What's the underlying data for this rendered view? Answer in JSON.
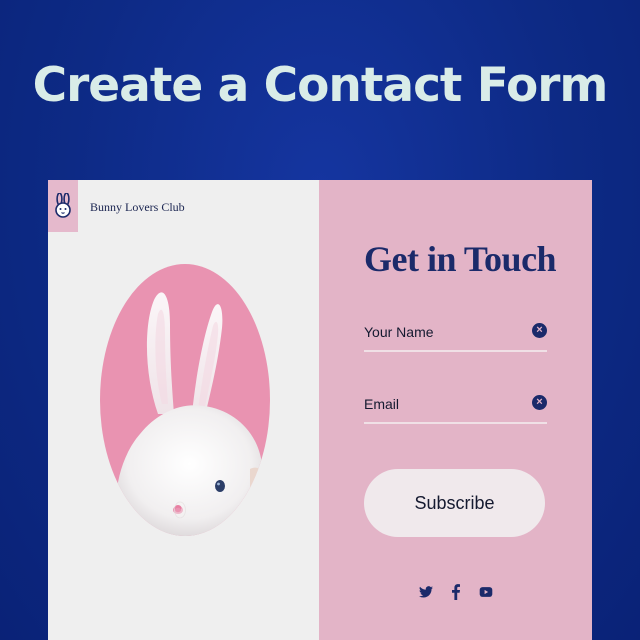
{
  "headline": "Create a Contact Form",
  "brand": {
    "name": "Bunny Lovers Club",
    "logo_icon": "bunny-icon"
  },
  "hero_image": {
    "icon": "bunny-photo"
  },
  "form": {
    "title": "Get in Touch",
    "fields": [
      {
        "label": "Your Name",
        "clear_icon": "clear-icon"
      },
      {
        "label": "Email",
        "clear_icon": "clear-icon"
      }
    ],
    "submit_label": "Subscribe"
  },
  "social": [
    "twitter-icon",
    "facebook-icon",
    "youtube-icon"
  ],
  "colors": {
    "background": "#0d2a85",
    "headline": "#d9ece8",
    "left_panel": "#efefef",
    "right_panel": "#e3b4c7",
    "accent_navy": "#1b2a6a",
    "photo_circle": "#e993b1",
    "button": "#f0e9ec"
  }
}
